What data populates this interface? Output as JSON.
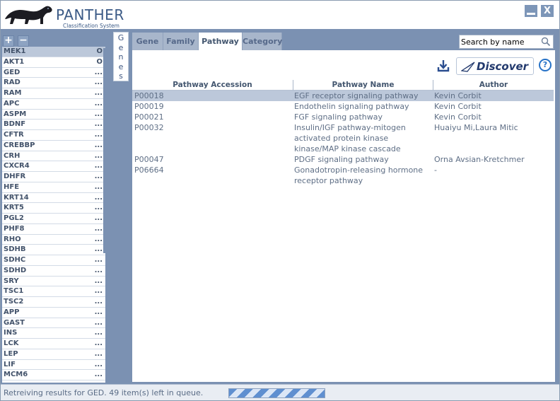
{
  "app": {
    "logo_title": "PANTHER",
    "logo_subtitle": "Classification System",
    "minimize_icon": "minimize-icon",
    "close_label": "X"
  },
  "gene_list": {
    "add_label": "+",
    "remove_label": "−",
    "items": [
      {
        "name": "MEK1",
        "status": "O",
        "selected": true
      },
      {
        "name": "AKT1",
        "status": "O"
      },
      {
        "name": "GED",
        "status": "..."
      },
      {
        "name": "RAD",
        "status": "..."
      },
      {
        "name": "RAM",
        "status": "..."
      },
      {
        "name": "APC",
        "status": "..."
      },
      {
        "name": "ASPM",
        "status": "..."
      },
      {
        "name": "BDNF",
        "status": "..."
      },
      {
        "name": "CFTR",
        "status": "..."
      },
      {
        "name": "CREBBP",
        "status": "..."
      },
      {
        "name": "CRH",
        "status": "..."
      },
      {
        "name": "CXCR4",
        "status": "..."
      },
      {
        "name": "DHFR",
        "status": "..."
      },
      {
        "name": "HFE",
        "status": "..."
      },
      {
        "name": "KRT14",
        "status": "..."
      },
      {
        "name": "KRT5",
        "status": "..."
      },
      {
        "name": "PGL2",
        "status": "..."
      },
      {
        "name": "PHF8",
        "status": "..."
      },
      {
        "name": "RHO",
        "status": "..."
      },
      {
        "name": "SDHB",
        "status": "..."
      },
      {
        "name": "SDHC",
        "status": "..."
      },
      {
        "name": "SDHD",
        "status": "..."
      },
      {
        "name": "SRY",
        "status": "..."
      },
      {
        "name": "TSC1",
        "status": "..."
      },
      {
        "name": "TSC2",
        "status": "..."
      },
      {
        "name": "APP",
        "status": "..."
      },
      {
        "name": "GAST",
        "status": "..."
      },
      {
        "name": "INS",
        "status": "..."
      },
      {
        "name": "LCK",
        "status": "..."
      },
      {
        "name": "LEP",
        "status": "..."
      },
      {
        "name": "LIF",
        "status": "..."
      },
      {
        "name": "MCM6",
        "status": "..."
      }
    ]
  },
  "side_tab": {
    "label_chars": [
      "G",
      "e",
      "n",
      "e",
      "s"
    ]
  },
  "tabs": [
    {
      "label": "Gene"
    },
    {
      "label": "Family"
    },
    {
      "label": "Pathway",
      "active": true
    },
    {
      "label": "Category"
    }
  ],
  "search": {
    "value": "Search by name",
    "icon": "search-icon"
  },
  "toolbar": {
    "download_icon": "download-icon",
    "discover_label": "Discover",
    "help_label": "?"
  },
  "table": {
    "headers": {
      "accession": "Pathway Accession",
      "name": "Pathway Name",
      "author": "Author"
    },
    "rows": [
      {
        "accession": "P00018",
        "name": [
          "EGF receptor signaling pathway"
        ],
        "author": "Kevin Corbit",
        "selected": true
      },
      {
        "accession": "P00019",
        "name": [
          "Endothelin signaling pathway"
        ],
        "author": "Kevin Corbit"
      },
      {
        "accession": "P00021",
        "name": [
          "FGF signaling pathway"
        ],
        "author": "Kevin Corbit"
      },
      {
        "accession": "P00032",
        "name": [
          "Insulin/IGF pathway-mitogen",
          "activated protein kinase",
          "kinase/MAP kinase cascade"
        ],
        "author": "Huaiyu Mi,Laura Mitic"
      },
      {
        "accession": "P00047",
        "name": [
          "PDGF signaling pathway"
        ],
        "author": "Orna Avsian-Kretchmer"
      },
      {
        "accession": "P06664",
        "name": [
          "Gonadotropin-releasing hormone",
          "receptor pathway"
        ],
        "author": "-"
      }
    ]
  },
  "status": {
    "text": "Retreiving results for GED. 49 item(s) left in queue."
  }
}
